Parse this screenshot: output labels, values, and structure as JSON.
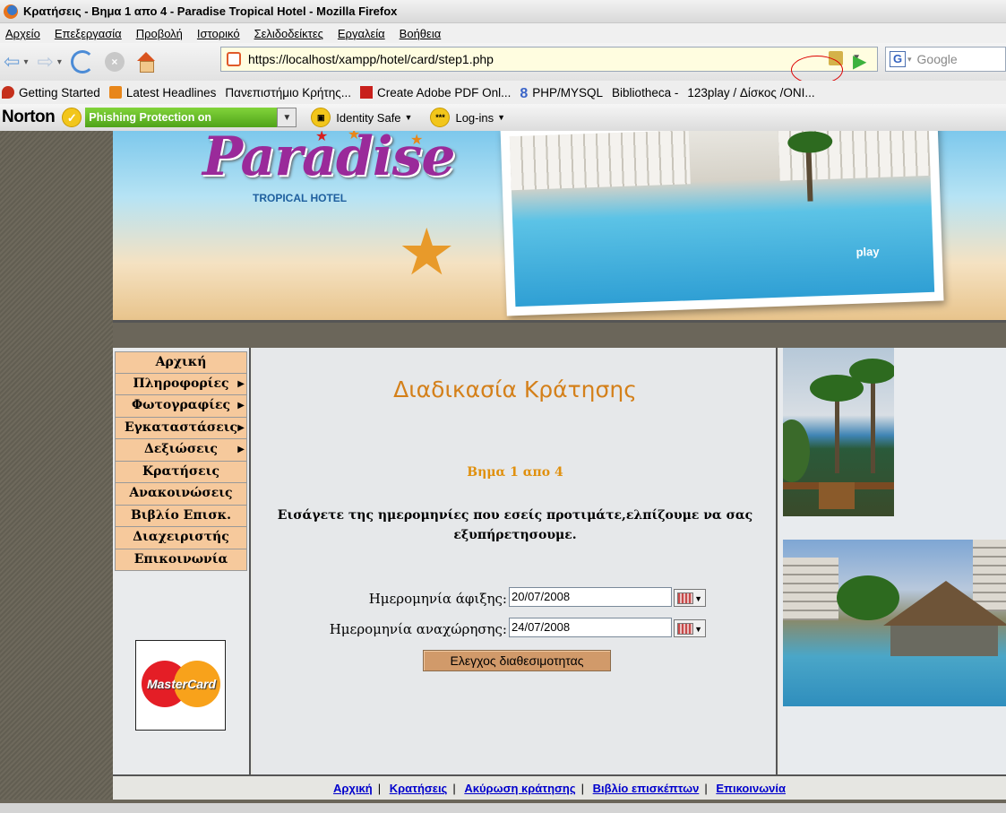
{
  "browser": {
    "title": "Κρατήσεις - Βημα 1 απο 4 - Paradise Tropical Hotel - Mozilla Firefox",
    "menu": [
      "Αρχείο",
      "Επεξεργασία",
      "Προβολή",
      "Ιστορικό",
      "Σελιδοδείκτες",
      "Εργαλεία",
      "Βοήθεια"
    ],
    "url": "https://localhost/xampp/hotel/card/step1.php",
    "search_placeholder": "Google",
    "bookmarks": [
      "Getting Started",
      "Latest Headlines",
      "Πανεπιστήμιο Κρήτης...",
      "Create Adobe PDF Onl...",
      "PHP/MYSQL",
      "Bibliotheca -",
      "123play / Δίσκος /ONI..."
    ],
    "norton": {
      "logo": "Norton",
      "phishing": "Phishing Protection on",
      "identity": "Identity Safe",
      "logins": "Log-ins",
      "logins_icon_text": "***"
    }
  },
  "banner": {
    "logo": "Paradise",
    "subtitle": "TROPICAL HOTEL",
    "play": "play"
  },
  "sidebar": {
    "items": [
      {
        "label": "Αρχική",
        "submenu": false
      },
      {
        "label": "Πληροφορίες",
        "submenu": true
      },
      {
        "label": "Φωτογραφίες",
        "submenu": true
      },
      {
        "label": "Εγκαταστάσεις",
        "submenu": true
      },
      {
        "label": "Δεξιώσεις",
        "submenu": true
      },
      {
        "label": "Κρατήσεις",
        "submenu": false
      },
      {
        "label": "Ανακοινώσεις",
        "submenu": false
      },
      {
        "label": "Βιβλίο Επισκ.",
        "submenu": false
      },
      {
        "label": "Διαχειριστής",
        "submenu": false
      },
      {
        "label": "Επικοινωνία",
        "submenu": false
      }
    ],
    "mastercard": "MasterCard"
  },
  "main": {
    "title": "Διαδικασία Κράτησης",
    "step": "Βημα 1 απο 4",
    "intro": "Εισάγετε της ημερομηνίες που εσείς προτιμάτε,ελπίζουμε να σας εξυπήρετησουμε.",
    "arrival_label": "Ημερομηνία άφιξης:",
    "arrival_value": "20/07/2008",
    "departure_label": "Ημερομηνία αναχώρησης:",
    "departure_value": "24/07/2008",
    "check_button": "Ελεγχος διαθεσιμοτητας"
  },
  "footer": {
    "links": [
      "Αρχική",
      "Κρατήσεις",
      "Ακύρωση κράτησης",
      "Βιβλίο επισκέπτων",
      "Επικοινωνία"
    ]
  }
}
